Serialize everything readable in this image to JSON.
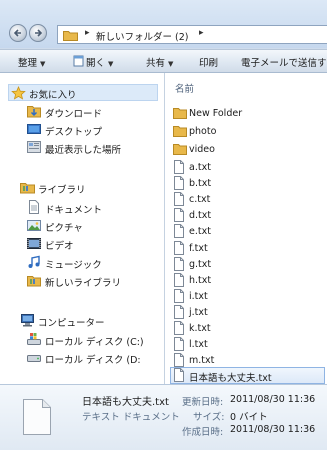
{
  "address": {
    "path": "新しいフォルダー (2)",
    "sep": "▸"
  },
  "toolbar": {
    "organize": "整理",
    "open": "開く",
    "share": "共有",
    "print": "印刷",
    "email": "電子メールで送信す",
    "dropdown_glyph": "▼"
  },
  "nav": {
    "favorites": "お気に入り",
    "downloads": "ダウンロード",
    "desktop": "デスクトップ",
    "recent": "最近表示した場所",
    "libraries": "ライブラリ",
    "documents": "ドキュメント",
    "pictures": "ピクチャ",
    "videos": "ビデオ",
    "music": "ミュージック",
    "new_library": "新しいライブラリ",
    "computer": "コンピューター",
    "disk_c": "ローカル ディスク (C:)",
    "disk_d": "ローカル ディスク (D:"
  },
  "list": {
    "column_name": "名前",
    "folders": [
      "New Folder",
      "photo",
      "video"
    ],
    "files": [
      "a.txt",
      "b.txt",
      "c.txt",
      "d.txt",
      "e.txt",
      "f.txt",
      "g.txt",
      "h.txt",
      "i.txt",
      "j.txt",
      "k.txt",
      "l.txt",
      "m.txt"
    ],
    "selected_file": "日本語も大丈夫.txt"
  },
  "details": {
    "name": "日本語も大丈夫.txt",
    "type": "テキスト ドキュメント",
    "modified_label": "更新日時:",
    "modified_value": "2011/08/30 11:36",
    "size_label": "サイズ:",
    "size_value": "0 バイト",
    "created_label": "作成日時:",
    "created_value": "2011/08/30 11:36"
  },
  "colors": {
    "selection": "#dde9f8",
    "chrome": "#cfdcec",
    "folder": "#e8b84a"
  }
}
